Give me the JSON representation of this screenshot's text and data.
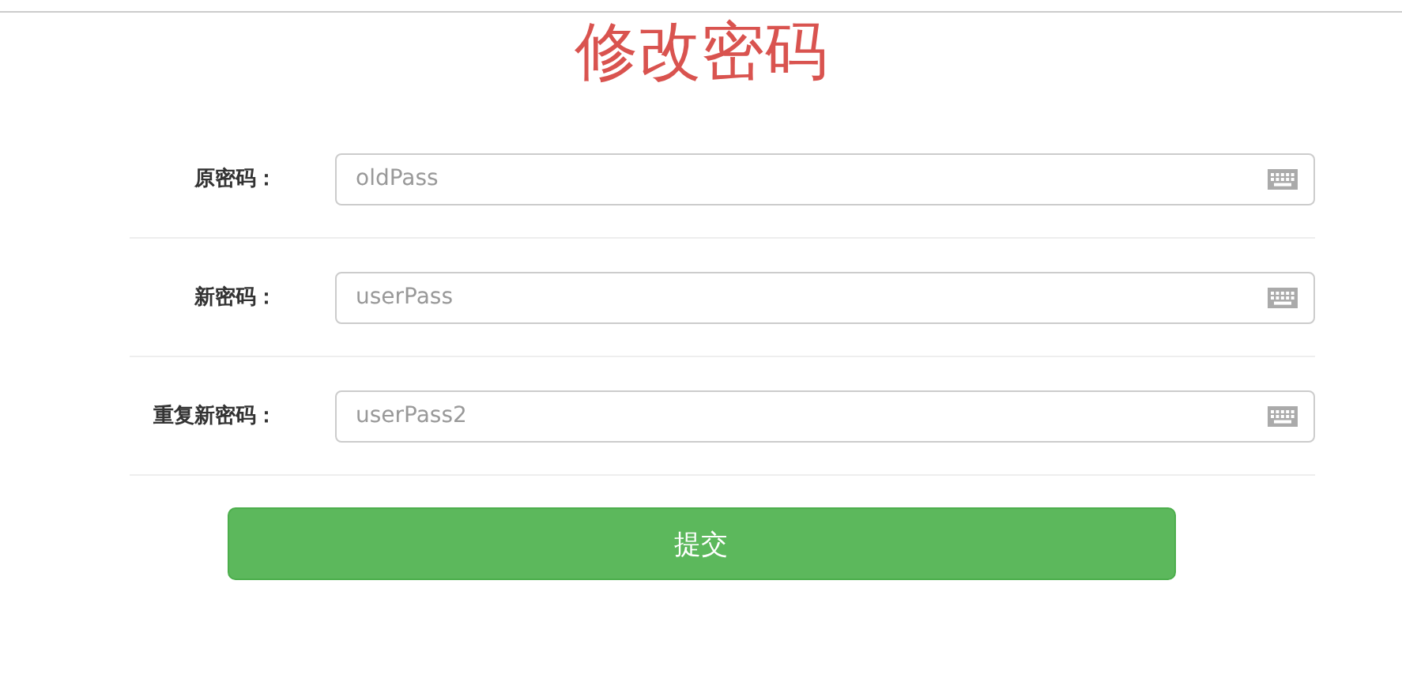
{
  "title": "修改密码",
  "fields": [
    {
      "label": "原密码：",
      "placeholder": "oldPass"
    },
    {
      "label": "新密码：",
      "placeholder": "userPass"
    },
    {
      "label": "重复新密码：",
      "placeholder": "userPass2"
    }
  ],
  "submit": "提交"
}
